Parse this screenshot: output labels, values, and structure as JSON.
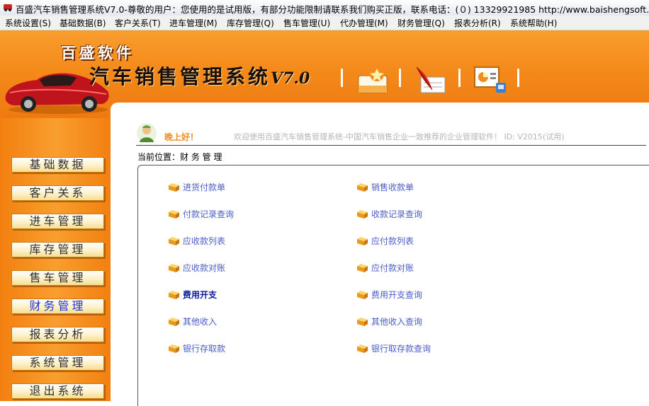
{
  "window": {
    "title": "百盛汽车销售管理系统V7.0-尊敬的用户：您使用的是试用版，有部分功能限制请联系我们购买正版，联系电话：(０) 13329921985  http://www.baishengsoft.com"
  },
  "menu": [
    "系统设置(S)",
    "基础数据(B)",
    "客户关系(T)",
    "进车管理(M)",
    "库存管理(Q)",
    "售车管理(U)",
    "代办管理(M)",
    "财务管理(Q)",
    "报表分析(R)",
    "系统帮助(H)"
  ],
  "banner": {
    "brand": "百盛软件",
    "product": "汽车销售管理系统",
    "version": "V7.0"
  },
  "sidebar": [
    "基础数据",
    "客户关系",
    "进车管理",
    "库存管理",
    "售车管理",
    "财务管理",
    "报表分析",
    "系统管理",
    "退出系统"
  ],
  "content": {
    "greeting": "晚上好！",
    "welcome": "欢迎使用百盛汽车销售管理系统-中国汽车销售企业一致推荐的企业管理软件！ ID: V2015(试用)",
    "location": "当前位置：财 务 管 理",
    "links_left": [
      "进货付款单",
      "付款记录查询",
      "应收款列表",
      "应收款对账",
      "费用开支",
      "其他收入",
      "银行存取款"
    ],
    "links_right": [
      "销售收款单",
      "收款记录查询",
      "应付款列表",
      "应付款对账",
      "费用开支查询",
      "其他收入查询",
      "银行取存款查询"
    ]
  },
  "colors": {
    "banner_orange": "#f48a1a",
    "link": "#4a5cc9",
    "active_link": "#0a1a9a",
    "active_side": "#2233cc"
  }
}
